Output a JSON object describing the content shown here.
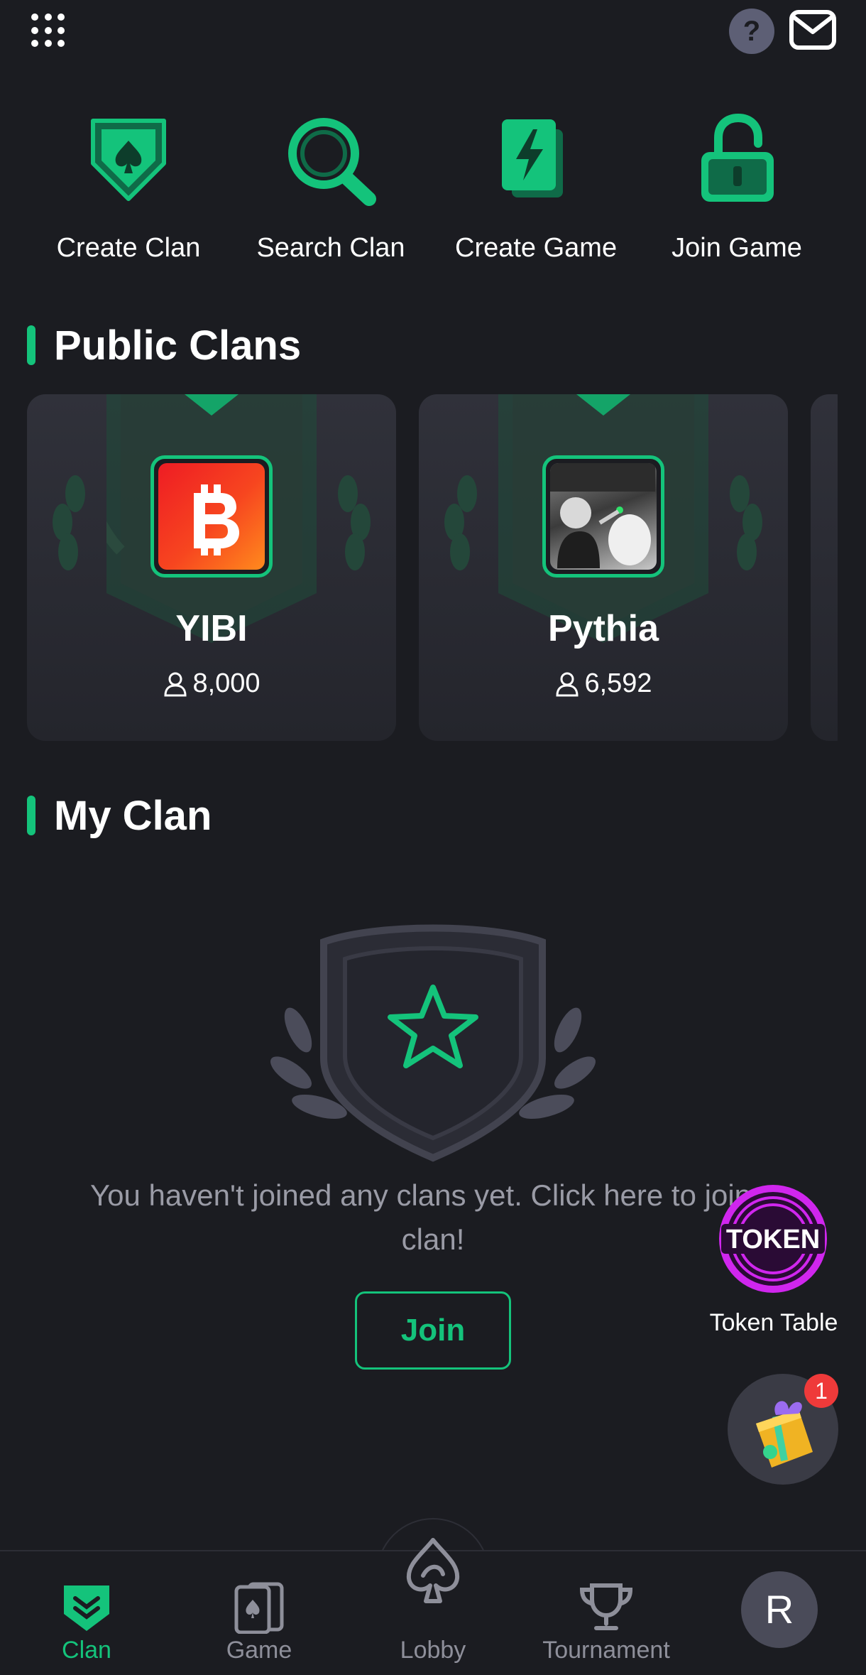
{
  "header": {
    "menu_icon": "grid-menu-icon",
    "help_icon": "help-icon",
    "help_glyph": "?",
    "mail_icon": "mail-icon"
  },
  "actions": [
    {
      "label": "Create Clan",
      "icon": "spade-shield-icon"
    },
    {
      "label": "Search Clan",
      "icon": "search-icon"
    },
    {
      "label": "Create Game",
      "icon": "lightning-card-icon"
    },
    {
      "label": "Join Game",
      "icon": "unlock-icon"
    }
  ],
  "public_clans": {
    "title": "Public Clans",
    "items": [
      {
        "name": "YIBI",
        "members": "8,000"
      },
      {
        "name": "Pythia",
        "members": "6,592"
      }
    ]
  },
  "my_clan": {
    "title": "My Clan",
    "empty_message": "You haven't joined any clans yet. Click here to join a clan!",
    "join_label": "Join"
  },
  "floating": {
    "token_badge": "TOKEN",
    "token_label": "Token Table",
    "gift_count": "1"
  },
  "bottom_nav": {
    "items": [
      {
        "label": "Clan",
        "active": true
      },
      {
        "label": "Game",
        "active": false
      },
      {
        "label": "Lobby",
        "active": false
      },
      {
        "label": "Tournament",
        "active": false
      }
    ],
    "avatar_initial": "R"
  },
  "colors": {
    "background": "#1b1c21",
    "accent": "#14c37b",
    "card": "#2a2b33",
    "muted_text": "#9a9ba6"
  }
}
